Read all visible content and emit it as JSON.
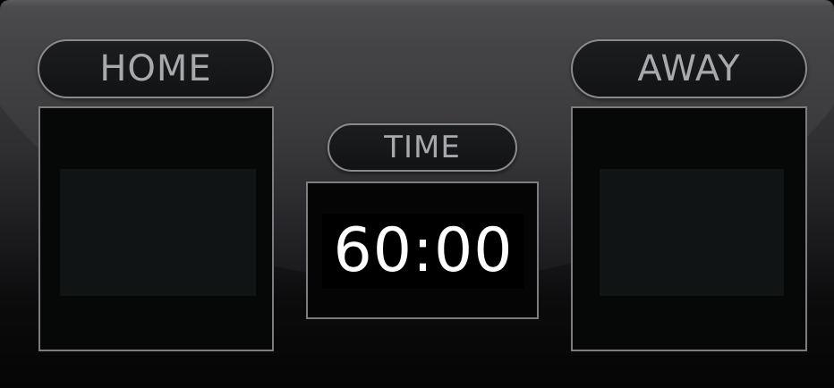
{
  "scoreboard": {
    "home": {
      "label": "HOME",
      "score": ""
    },
    "away": {
      "label": "AWAY",
      "score": ""
    },
    "time": {
      "label": "TIME",
      "value": "60:00"
    }
  },
  "colors": {
    "label_text": "#a9a9ad",
    "border": "#7d7d81",
    "panel": "#111415",
    "clock_text": "#ffffff"
  }
}
